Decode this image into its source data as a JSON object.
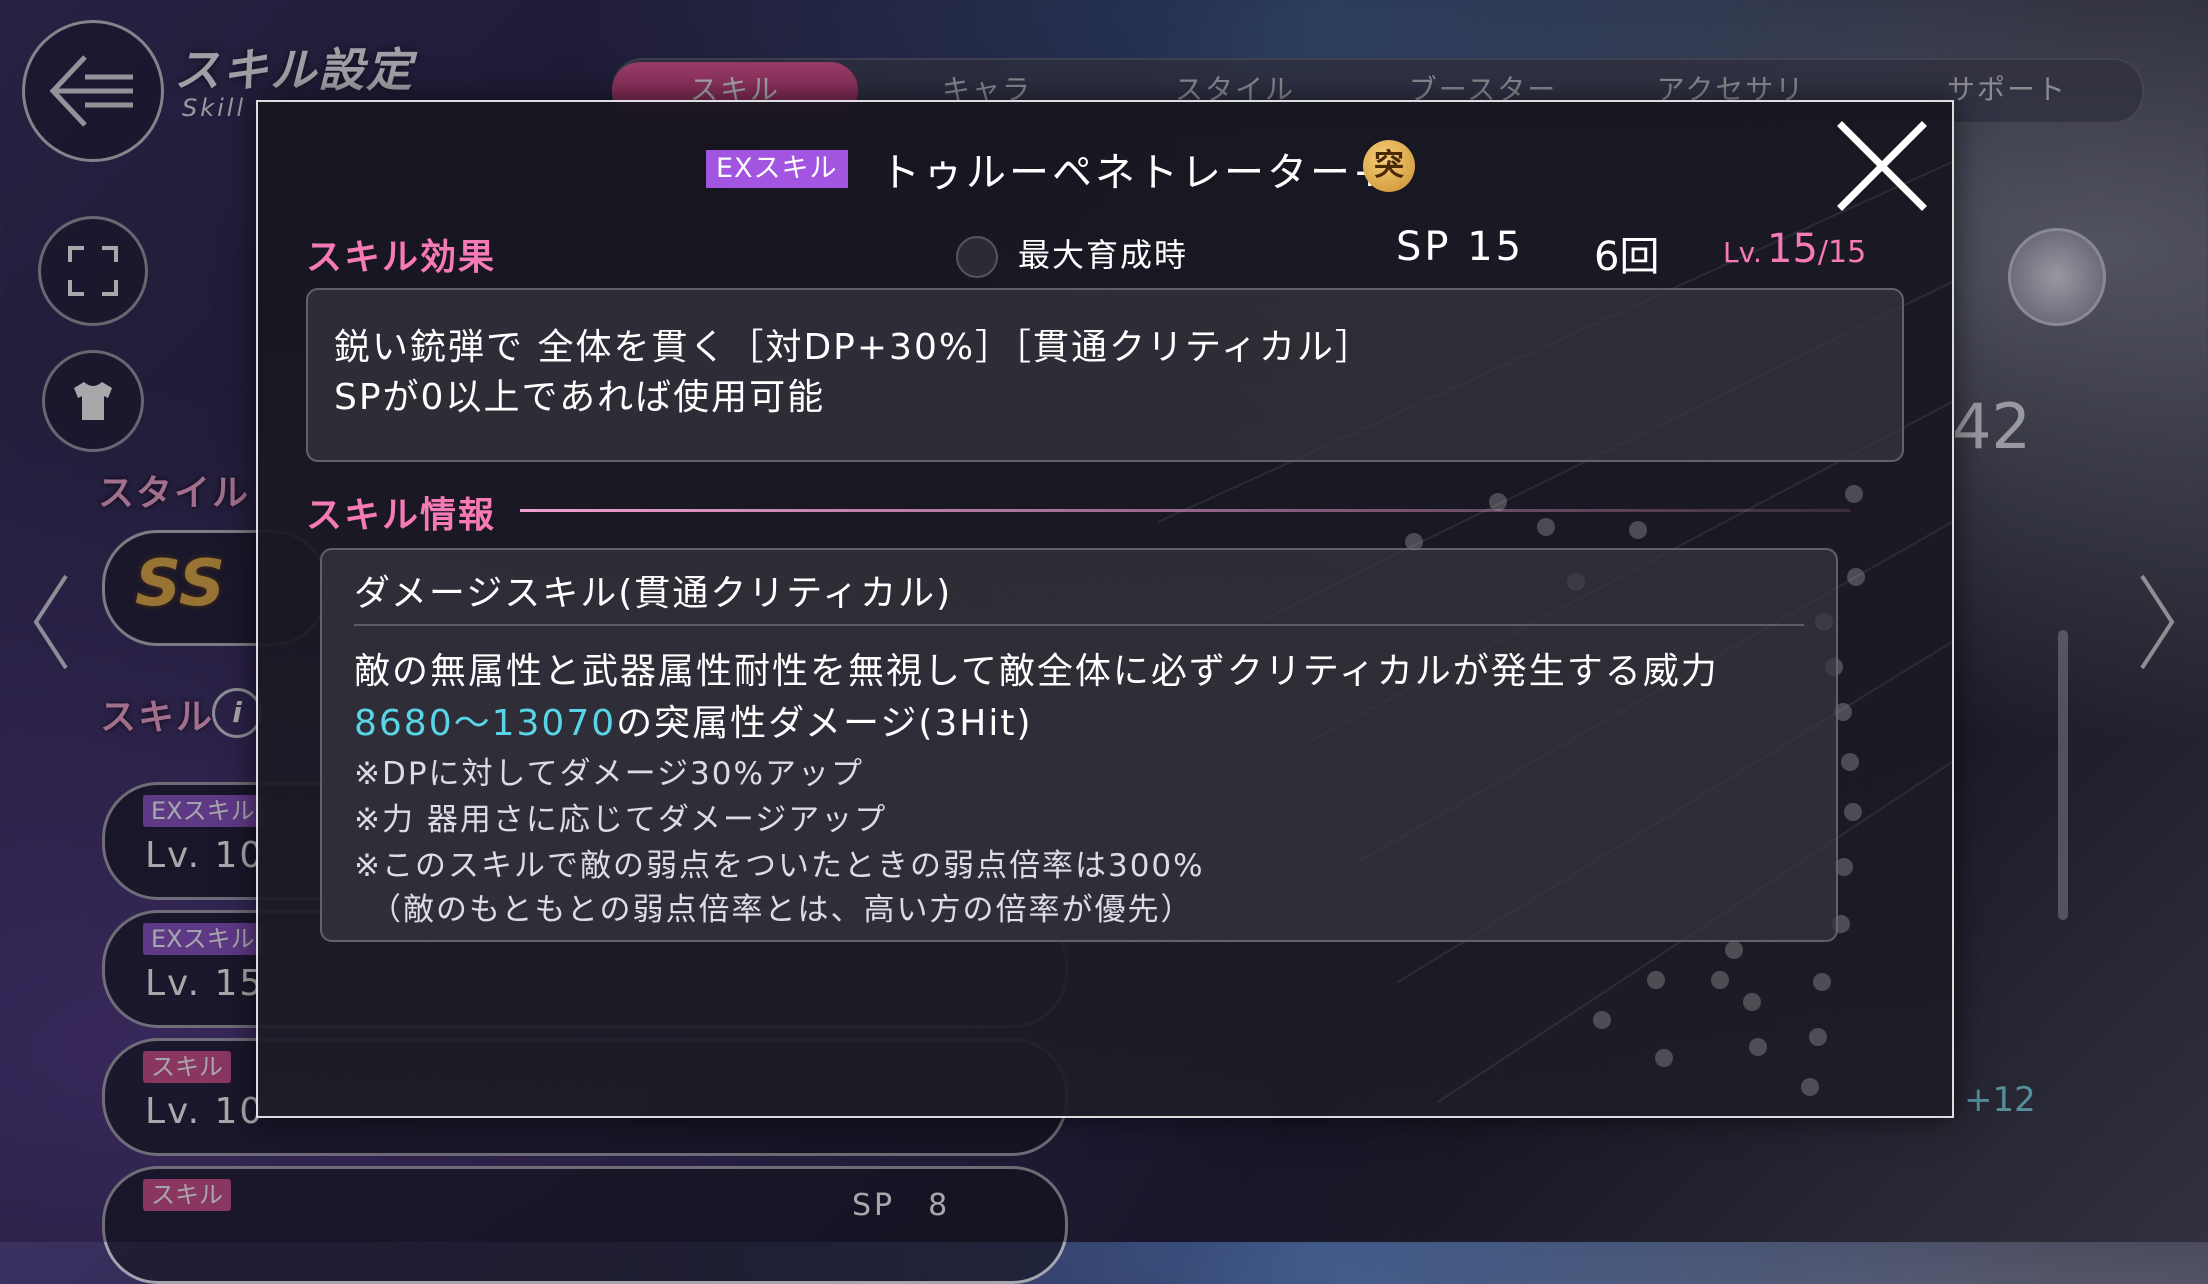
{
  "screen": {
    "title": "スキル設定",
    "subtitle": "Skill"
  },
  "tabs": [
    {
      "label": "スキル",
      "active": true
    },
    {
      "label": "キャラ",
      "active": false
    },
    {
      "label": "スタイル",
      "active": false
    },
    {
      "label": "ブースター",
      "active": false
    },
    {
      "label": "アクセサリ",
      "active": false
    },
    {
      "label": "サポート",
      "active": false
    }
  ],
  "sidebar": {
    "style_label": "スタイル",
    "style_rank": "SS",
    "skill_label": "スキル",
    "skill_cards": [
      {
        "tag": "EXスキル",
        "level": "Lv. 10",
        "kind": "ex"
      },
      {
        "tag": "EXスキル",
        "level": "Lv. 15",
        "kind": "ex"
      },
      {
        "tag": "スキル",
        "level": "Lv. 10",
        "kind": "normal"
      },
      {
        "tag": "スキル",
        "level": "",
        "kind": "normal"
      }
    ],
    "bottom_sp": "SP　8"
  },
  "stats": {
    "big_value": "42",
    "bonus": "+12"
  },
  "modal": {
    "ex_badge": "EXスキル",
    "skill_name": "トゥルーペネトレーター+",
    "element_icon": "突",
    "effect_title": "スキル効果",
    "max_training_label": "最大育成時",
    "sp": "SP 15",
    "uses": "6回",
    "level_prefix": "Lv.",
    "level_current": "15",
    "level_max": "/15",
    "effect_lines": [
      "鋭い銃弾で 全体を貫く［対DP+30%］［貫通クリティカル］",
      "SPが0以上であれば使用可能"
    ],
    "info_title": "スキル情報",
    "info_type": "ダメージスキル(貫通クリティカル)",
    "info_desc_1": "敵の無属性と武器属性耐性を無視して敵全体に必ずクリティカルが発生する威力",
    "info_damage_range": "8680～13070",
    "info_desc_2_rest": "の突属性ダメージ(3Hit)",
    "notes": [
      "※DPに対してダメージ30%アップ",
      "※力 器用さに応じてダメージアップ",
      "※このスキルで敵の弱点をついたときの弱点倍率は300%",
      "（敵のもともとの弱点倍率とは、高い方の倍率が優先）"
    ]
  },
  "colors": {
    "accent_pink": "#f57ab5",
    "ex_purple": "#a155e0",
    "damage_cyan": "#58d6e8",
    "element_gold": "#d9a046"
  }
}
